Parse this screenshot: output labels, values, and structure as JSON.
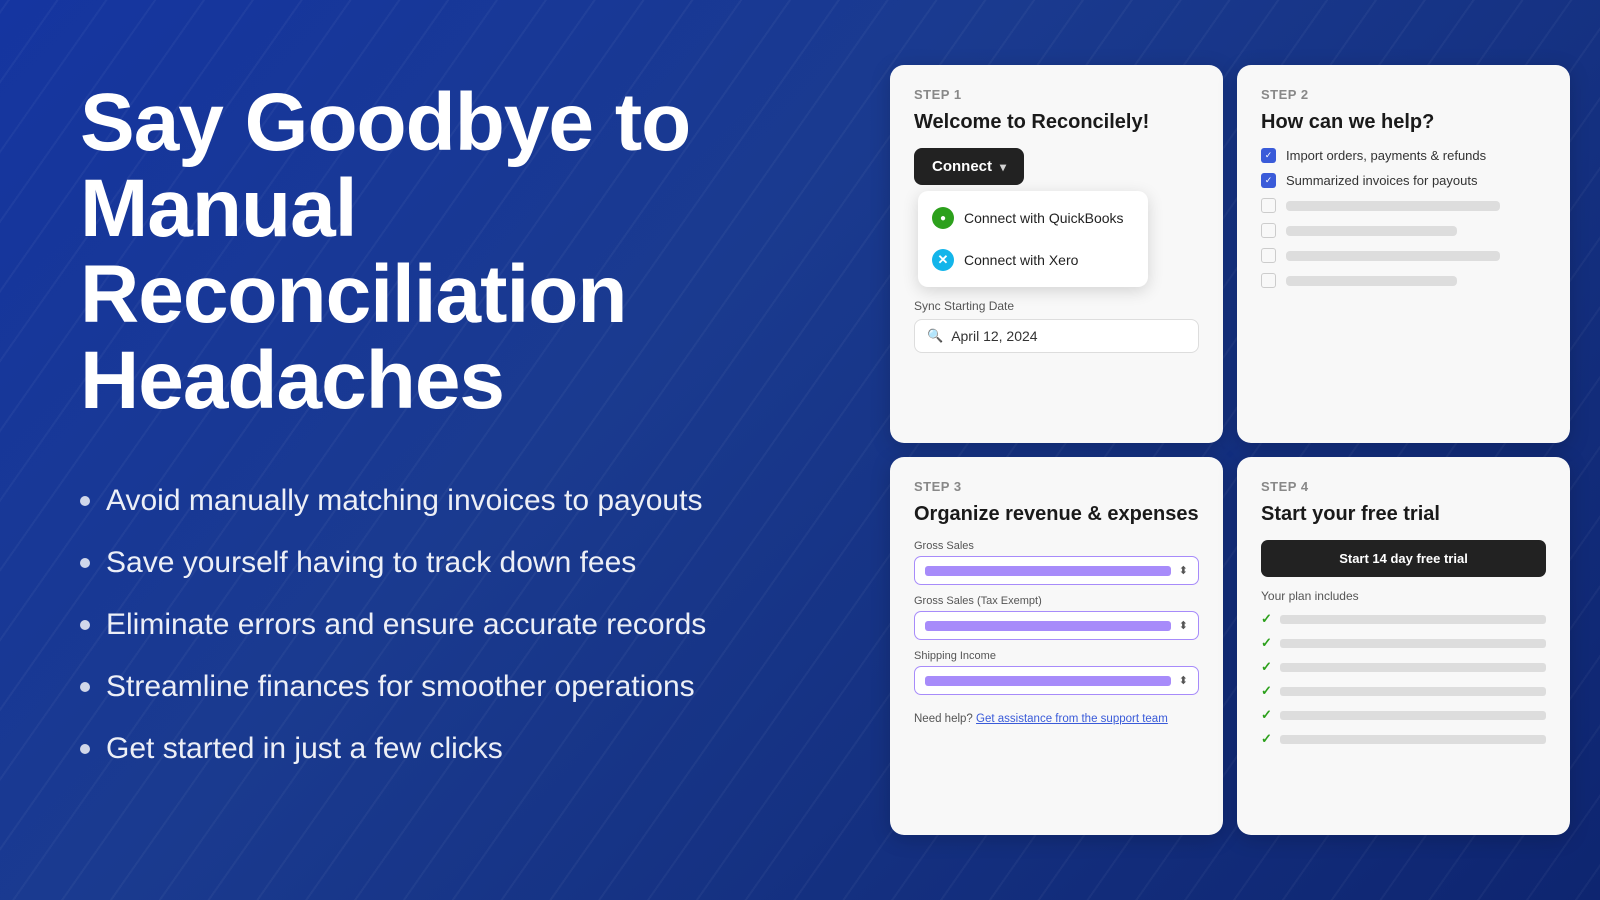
{
  "background": {
    "color": "#1535a0"
  },
  "left": {
    "headline_line1": "Say Goodbye to Manual",
    "headline_line2": "Reconciliation Headaches",
    "bullets": [
      "Avoid manually matching invoices to payouts",
      "Save yourself having to track down fees",
      "Eliminate errors and ensure accurate records",
      "Streamline finances for smoother operations",
      "Get started in just a few clicks"
    ]
  },
  "step1": {
    "step_label": "STEP 1",
    "title": "Welcome to Reconcilely!",
    "connect_button": "Connect",
    "dropdown": {
      "item1": "Connect with QuickBooks",
      "item2": "Connect with Xero"
    },
    "sync_label": "Sync Starting Date",
    "sync_date": "April 12, 2024"
  },
  "step2": {
    "step_label": "STEP 2",
    "title": "How can we help?",
    "checked_items": [
      "Import orders, payments & refunds",
      "Summarized invoices for payouts"
    ]
  },
  "step3": {
    "step_label": "STEP 3",
    "title": "Organize revenue & expenses",
    "field1_label": "Gross Sales",
    "field2_label": "Gross Sales (Tax Exempt)",
    "field3_label": "Shipping Income",
    "help_text": "Need help?",
    "help_link": "Get assistance from the support team"
  },
  "step4": {
    "step_label": "STEP 4",
    "title": "Start your free trial",
    "cta_button": "Start 14 day free trial",
    "plan_label": "Your plan includes"
  }
}
